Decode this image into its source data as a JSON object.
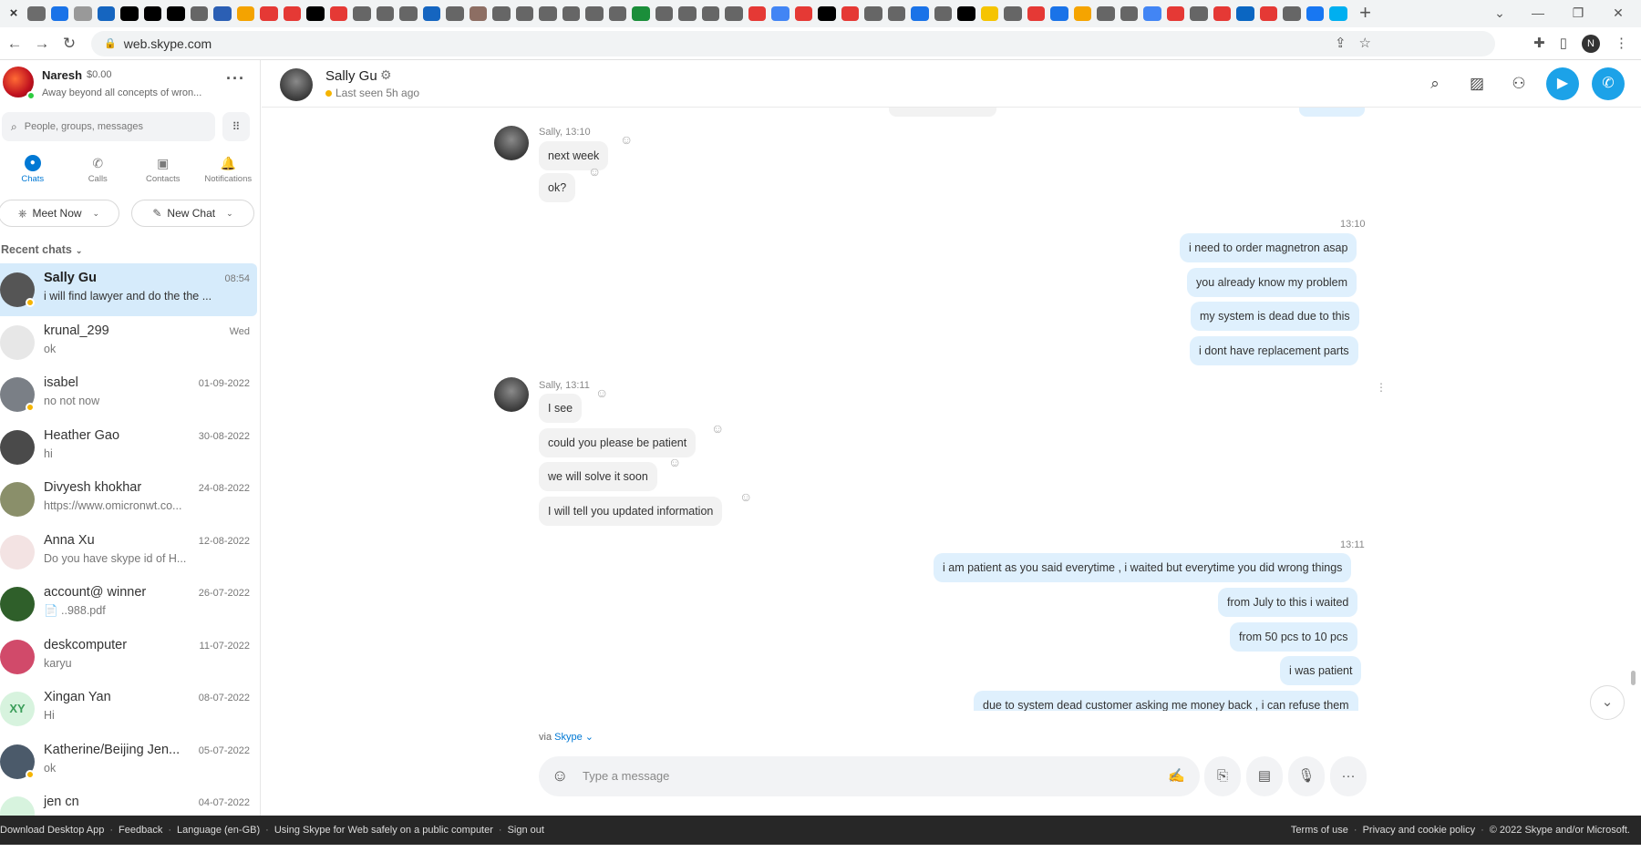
{
  "browser": {
    "tab_close": "×",
    "new_tab": "+",
    "window_controls": [
      "⌄",
      "—",
      "❐",
      "✕"
    ],
    "url": "web.skype.com",
    "favicon_colors": [
      "#6c6c6c",
      "#1a73e8",
      "#999",
      "#1565c0",
      "#000",
      "#000",
      "#000",
      "#666",
      "#2b5fb4",
      "#f4a300",
      "#e53935",
      "#e53935",
      "#000",
      "#e53935",
      "#666",
      "#666",
      "#666",
      "#1565c0",
      "#666",
      "#8d6e63",
      "#666",
      "#666",
      "#666",
      "#666",
      "#666",
      "#666",
      "#1b8e3a",
      "#666",
      "#666",
      "#666",
      "#666",
      "#e53935",
      "#4285f4",
      "#e53935",
      "#000",
      "#e53935",
      "#666",
      "#666",
      "#1a73e8",
      "#666",
      "#000",
      "#f5c400",
      "#666",
      "#e53935",
      "#1a73e8",
      "#f5a400",
      "#666",
      "#666",
      "#4285f4",
      "#e53935",
      "#666",
      "#e53935",
      "#0a66c2",
      "#e53935",
      "#666",
      "#1877f2",
      "#00aff0"
    ]
  },
  "profile": {
    "name": "Naresh",
    "credit": "$0.00",
    "mood": "Away beyond all concepts of wron...",
    "more": "···",
    "initial": "N"
  },
  "search": {
    "placeholder": "People, groups, messages"
  },
  "nav_tabs": [
    {
      "label": "Chats",
      "icon": "chat-icon",
      "glyph": "●"
    },
    {
      "label": "Calls",
      "icon": "phone-icon",
      "glyph": "✆"
    },
    {
      "label": "Contacts",
      "icon": "contacts-icon",
      "glyph": "▣"
    },
    {
      "label": "Notifications",
      "icon": "bell-icon",
      "glyph": "🔔"
    }
  ],
  "actions": {
    "meet_now": "Meet Now",
    "new_chat": "New Chat"
  },
  "recent_label": "Recent chats",
  "chats": [
    {
      "name": "Sally Gu",
      "date": "08:54",
      "preview": "i will find lawyer and do the the ...",
      "color": "#555555",
      "presence": true
    },
    {
      "name": "krunal_299",
      "date": "Wed",
      "preview": "ok",
      "color": "#e7e7e7",
      "presence": false
    },
    {
      "name": "isabel",
      "date": "01-09-2022",
      "preview": "no not now",
      "color": "#7a7f86",
      "presence": true
    },
    {
      "name": "Heather Gao",
      "date": "30-08-2022",
      "preview": "hi",
      "color": "#4a4a4a",
      "presence": false
    },
    {
      "name": "Divyesh khokhar",
      "date": "24-08-2022",
      "preview": "https://www.omicronwt.co...",
      "color": "#8a8f6a",
      "presence": false
    },
    {
      "name": "Anna Xu",
      "date": "12-08-2022",
      "preview": "Do you have skype id of H...",
      "color": "#f3e3e3",
      "presence": false
    },
    {
      "name": "account@ winner",
      "date": "26-07-2022",
      "preview": "📄 ..988.pdf",
      "color": "#2f5f2a",
      "presence": false
    },
    {
      "name": "deskcomputer",
      "date": "11-07-2022",
      "preview": "karyu",
      "color": "#d14a6a",
      "presence": false
    },
    {
      "name": "Xingan  Yan",
      "date": "08-07-2022",
      "preview": "Hi",
      "color": "#d7f3de",
      "presence": false,
      "initials": "XY"
    },
    {
      "name": "Katherine/Beijing Jen...",
      "date": "05-07-2022",
      "preview": "ok",
      "color": "#4b5a6a",
      "presence": true
    },
    {
      "name": "jen cn",
      "date": "04-07-2022",
      "preview": "",
      "color": "#d7f3de",
      "presence": false
    }
  ],
  "conversation": {
    "name": "Sally Gu",
    "last_seen": "Last seen 5h ago",
    "messages_in_1": {
      "sender": "Sally, 13:10",
      "items": [
        "next week",
        "ok?"
      ]
    },
    "messages_out_1": {
      "time": "13:10",
      "items": [
        "i need to order magnetron asap",
        "you already know my problem",
        "my system is dead due to this",
        "i dont have replacement parts"
      ]
    },
    "messages_in_2": {
      "sender": "Sally, 13:11",
      "items": [
        "I see",
        "could you please be patient",
        "we will solve it soon",
        "I will tell you updated information"
      ]
    },
    "messages_out_2": {
      "time": "13:11",
      "items": [
        "i am patient as you said everytime , i waited but everytime you did wrong things",
        "from July to this i waited",
        "from 50 pcs to 10 pcs",
        "i was patient",
        "due to system dead customer asking me money back , i can refuse them"
      ]
    },
    "via_prefix": "via",
    "via_link": "Skype"
  },
  "composer": {
    "placeholder": "Type a message"
  },
  "footer": {
    "left": [
      "Download Desktop App",
      "Feedback",
      "Language (en-GB)",
      "Using Skype for Web safely on a public computer",
      "Sign out"
    ],
    "right": [
      "Terms of use",
      "Privacy and cookie policy",
      "© 2022 Skype and/or Microsoft."
    ]
  },
  "accent_color": "#0078d4",
  "call_button_color": "#1ca2e8"
}
